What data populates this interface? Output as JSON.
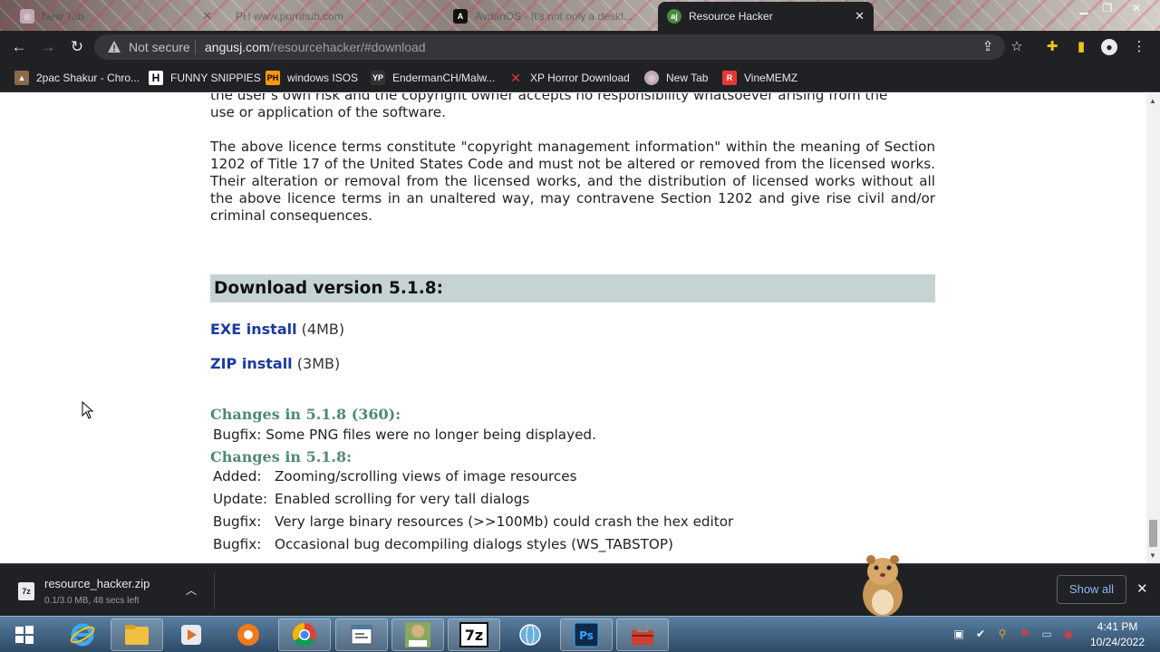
{
  "browser": {
    "tabs": [
      {
        "title": "New Tab",
        "active": false
      },
      {
        "title": "PH www.pornhub.com",
        "active": false
      },
      {
        "title": "AvdanOS - It's not only a deskt...",
        "active": false
      },
      {
        "title": "Resource Hacker",
        "active": true
      }
    ],
    "security_label": "Not secure",
    "url_domain": "angusj.com",
    "url_path": "/resourcehacker/#download",
    "bookmarks": [
      {
        "label": "2pac Shakur - Chro...",
        "icon": "bookmark-2pac-icon"
      },
      {
        "label": "FUNNY SNIPPIES",
        "icon": "bookmark-h-icon"
      },
      {
        "label": "windows ISOS",
        "icon": "bookmark-ph-icon"
      },
      {
        "label": "EndermanCH/Malw...",
        "icon": "bookmark-yp-icon"
      },
      {
        "label": "XP Horror Download",
        "icon": "bookmark-x-icon"
      },
      {
        "label": "New Tab",
        "icon": "bookmark-globe-icon"
      },
      {
        "label": "VineMEMZ",
        "icon": "bookmark-r-icon"
      }
    ]
  },
  "page": {
    "partial_line_top": "the user's own risk and the copyright owner accepts no responsibility whatsoever arising from the",
    "partial_line_second": "use or application of the software.",
    "licence_paragraph": "The above licence terms constitute \"copyright management information\" within the meaning of Section 1202 of Title 17 of the United States Code and must not be altered or removed from the licensed works. Their alteration or removal from the licensed works, and the distribution of licensed works without all the above licence terms in an unaltered way, may contravene Section 1202 and give rise civil and/or criminal consequences.",
    "download_heading": "Download version 5.1.8:",
    "downloads": [
      {
        "link": "EXE install",
        "size": "(4MB)"
      },
      {
        "link": "ZIP install",
        "size": "(3MB)"
      }
    ],
    "changes_360_heading": "Changes in 5.1.8 (360):",
    "changes_360": [
      {
        "label": "Bugfix:",
        "text": "Some PNG files were no longer being displayed."
      }
    ],
    "changes_heading": "Changes in 5.1.8:",
    "changes": [
      {
        "label": "Added:",
        "text": "Zooming/scrolling views of image resources"
      },
      {
        "label": "Update:",
        "text": "Enabled scrolling for very tall dialogs"
      },
      {
        "label": "Bugfix:",
        "text": "Very large binary resources (>>100Mb) could crash the hex editor"
      },
      {
        "label": "Bugfix:",
        "text": "Occasional bug decompiling dialogs styles (WS_TABSTOP)"
      }
    ]
  },
  "download_shelf": {
    "filename": "resource_hacker.zip",
    "status": "0.1/3.0 MB, 48 secs left",
    "show_all": "Show all"
  },
  "taskbar": {
    "time": "4:41 PM",
    "date": "10/24/2022"
  }
}
